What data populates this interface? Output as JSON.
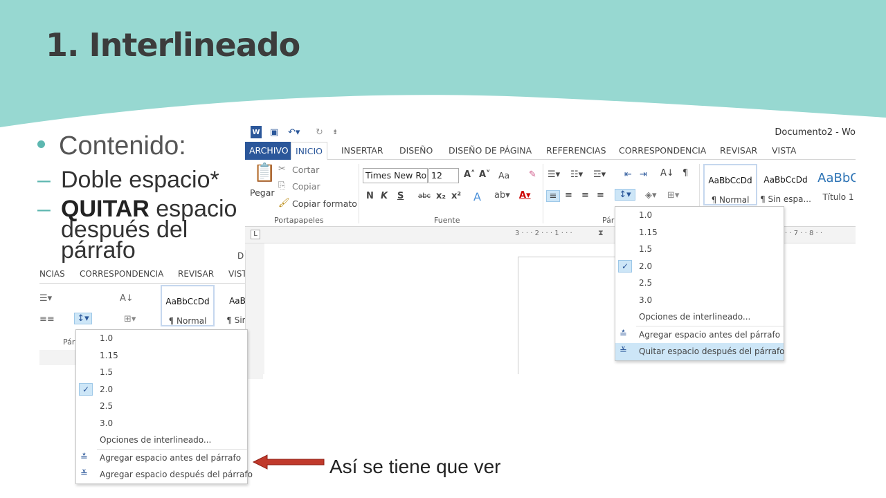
{
  "slide": {
    "title": "1. Interlineado",
    "bullet_main": "Contenido:",
    "sub1": "Doble espacio*",
    "sub2_strong": "QUITAR",
    "sub2_rest": "espacio después del párrafo",
    "caption": "Así se tiene que ver",
    "accent_color": "#5db7b0",
    "banner_color": "#97d8d1",
    "arrow_color": "#c0392b"
  },
  "word_right": {
    "doc_title": "Documento2 - Wo",
    "tabs": [
      "ARCHIVO",
      "INICIO",
      "INSERTAR",
      "DISEÑO",
      "DISEÑO DE PÁGINA",
      "REFERENCIAS",
      "CORRESPONDENCIA",
      "REVISAR",
      "VISTA"
    ],
    "clipboard": {
      "paste": "Pegar",
      "cut": "Cortar",
      "copy": "Copiar",
      "format_painter": "Copiar formato",
      "group": "Portapapeles"
    },
    "font": {
      "name": "Times New Ro",
      "size": "12",
      "group": "Fuente",
      "case": "Aa"
    },
    "paragraph_group": "Pár",
    "styles": [
      {
        "preview": "AaBbCcDd",
        "name": "¶ Normal"
      },
      {
        "preview": "AaBbCcDd",
        "name": "¶ Sin espa..."
      },
      {
        "preview": "AaBbC",
        "name": "Título 1"
      }
    ],
    "ruler_left": "3 · · · 2 · · · 1 · · ·",
    "ruler_right": "· · 7 · · 8 · ·",
    "menu": {
      "options": [
        "1.0",
        "1.15",
        "1.5",
        "2.0",
        "2.5",
        "3.0"
      ],
      "checked": "2.0",
      "more": "Opciones de interlineado...",
      "before": "Agregar espacio antes del párrafo",
      "after": "Quitar espacio después del párrafo"
    }
  },
  "word_left": {
    "tabs": [
      "NCIAS",
      "CORRESPONDENCIA",
      "REVISAR",
      "VIST"
    ],
    "doc_letter": "D",
    "styles": [
      {
        "preview": "AaBbCcDd",
        "name": "¶ Normal"
      },
      {
        "preview": "AaBbC",
        "name": "¶ Sin es"
      }
    ],
    "paragraph_group": "Pár",
    "menu": {
      "options": [
        "1.0",
        "1.15",
        "1.5",
        "2.0",
        "2.5",
        "3.0"
      ],
      "checked": "2.0",
      "more": "Opciones de interlineado...",
      "before": "Agregar espacio antes del párrafo",
      "after": "Agregar espacio después del párrafo"
    }
  }
}
